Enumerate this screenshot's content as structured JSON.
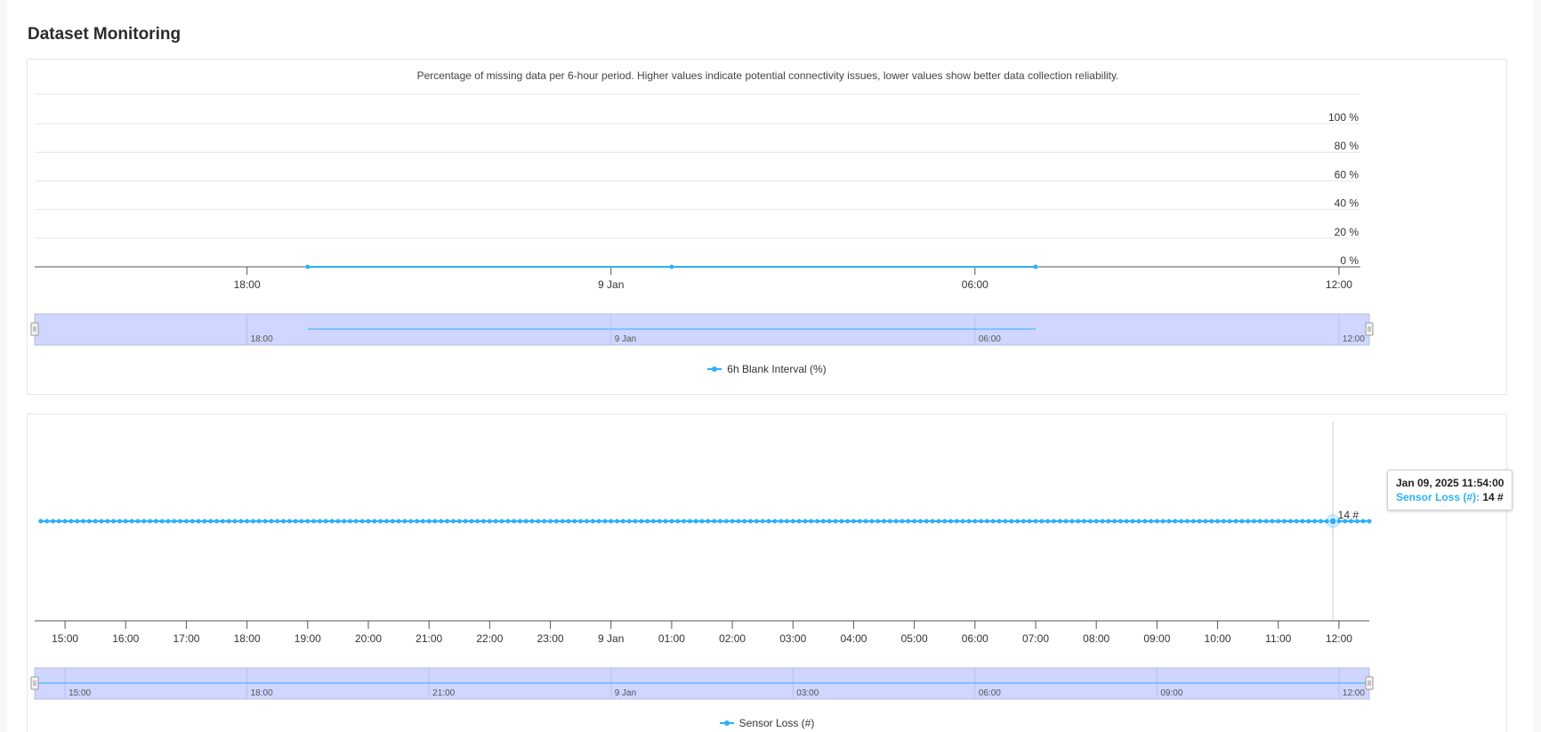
{
  "page": {
    "title": "Dataset Monitoring"
  },
  "colors": {
    "series": "#2caffe",
    "navigator_fill": "#cfd6ff",
    "grid": "#e6e6e6",
    "axis": "#333333"
  },
  "chart_data": [
    {
      "type": "line",
      "subtitle": "Percentage of missing data per 6-hour period. Higher values indicate potential connectivity issues, lower values show better data collection reliability.",
      "series": [
        {
          "name": "6h Blank Interval (%)",
          "x": [
            "2025-01-08 19:00",
            "2025-01-09 01:00",
            "2025-01-09 07:00"
          ],
          "y": [
            0,
            0,
            0
          ]
        }
      ],
      "y_axis": {
        "min": 0,
        "max": 100,
        "ticks": [
          0,
          20,
          40,
          60,
          80,
          100
        ],
        "tick_labels": [
          "0 %",
          "20 %",
          "40 %",
          "60 %",
          "80 %",
          "100 %"
        ],
        "position": "right"
      },
      "x_axis": {
        "range": [
          "2025-01-08 14:30",
          "2025-01-09 12:30"
        ],
        "ticks": [
          "2025-01-08 18:00",
          "2025-01-09 00:00",
          "2025-01-09 06:00",
          "2025-01-09 12:00"
        ],
        "tick_labels": [
          "18:00",
          "9 Jan",
          "06:00",
          "12:00"
        ]
      },
      "navigator": {
        "ticks": [
          "2025-01-08 18:00",
          "2025-01-09 00:00",
          "2025-01-09 06:00",
          "2025-01-09 12:00"
        ],
        "tick_labels": [
          "18:00",
          "9 Jan",
          "06:00",
          "12:00"
        ]
      },
      "grid": true,
      "legend": "bottom-center"
    },
    {
      "type": "line",
      "series": [
        {
          "name": "Sensor Loss (#)",
          "x_start": "2025-01-08 14:30",
          "x_end": "2025-01-09 12:30",
          "interval_minutes": 6,
          "value": 14
        }
      ],
      "y_axis": {
        "visible_label": "14 #",
        "value": 14,
        "position": "right"
      },
      "x_axis": {
        "range": [
          "2025-01-08 14:30",
          "2025-01-09 12:30"
        ],
        "ticks": [
          "2025-01-08 15:00",
          "2025-01-08 16:00",
          "2025-01-08 17:00",
          "2025-01-08 18:00",
          "2025-01-08 19:00",
          "2025-01-08 20:00",
          "2025-01-08 21:00",
          "2025-01-08 22:00",
          "2025-01-08 23:00",
          "2025-01-09 00:00",
          "2025-01-09 01:00",
          "2025-01-09 02:00",
          "2025-01-09 03:00",
          "2025-01-09 04:00",
          "2025-01-09 05:00",
          "2025-01-09 06:00",
          "2025-01-09 07:00",
          "2025-01-09 08:00",
          "2025-01-09 09:00",
          "2025-01-09 10:00",
          "2025-01-09 11:00",
          "2025-01-09 12:00"
        ],
        "tick_labels": [
          "15:00",
          "16:00",
          "17:00",
          "18:00",
          "19:00",
          "20:00",
          "21:00",
          "22:00",
          "23:00",
          "9 Jan",
          "01:00",
          "02:00",
          "03:00",
          "04:00",
          "05:00",
          "06:00",
          "07:00",
          "08:00",
          "09:00",
          "10:00",
          "11:00",
          "12:00"
        ]
      },
      "navigator": {
        "ticks": [
          "2025-01-08 15:00",
          "2025-01-08 18:00",
          "2025-01-08 21:00",
          "2025-01-09 00:00",
          "2025-01-09 03:00",
          "2025-01-09 06:00",
          "2025-01-09 09:00",
          "2025-01-09 12:00"
        ],
        "tick_labels": [
          "15:00",
          "18:00",
          "21:00",
          "9 Jan",
          "03:00",
          "06:00",
          "09:00",
          "12:00"
        ]
      },
      "tooltip": {
        "x": "2025-01-09 11:54",
        "date_label": "Jan 09, 2025 11:54:00",
        "series_label": "Sensor Loss (#)",
        "value_label": "14 #"
      },
      "legend": "bottom-center"
    }
  ]
}
